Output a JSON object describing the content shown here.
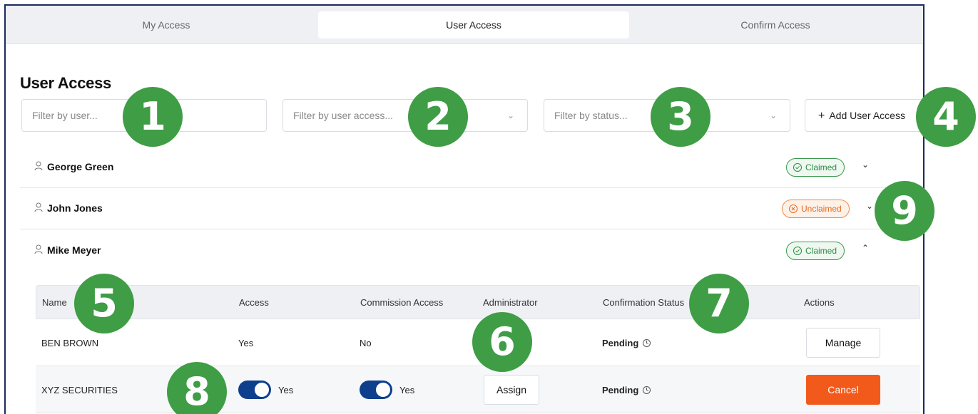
{
  "tabs": [
    {
      "label": "My Access"
    },
    {
      "label": "User Access"
    },
    {
      "label": "Confirm Access"
    }
  ],
  "page_title": "User Access",
  "filters": {
    "user_placeholder": "Filter by user...",
    "access_placeholder": "Filter by user access...",
    "status_placeholder": "Filter by status..."
  },
  "add_button": "Add User Access",
  "users": [
    {
      "name": "George Green",
      "status": "Claimed"
    },
    {
      "name": "John Jones",
      "status": "Unclaimed"
    },
    {
      "name": "Mike Meyer",
      "status": "Claimed"
    }
  ],
  "table": {
    "headers": [
      "Name",
      "Access",
      "Commission Access",
      "Administrator",
      "Confirmation Status",
      "Actions"
    ],
    "rows": [
      {
        "name": "BEN BROWN",
        "access": "Yes",
        "commission": "No",
        "status": "Pending",
        "action": "Manage"
      },
      {
        "name": "XYZ SECURITIES",
        "access": "Yes",
        "commission": "Yes",
        "admin": "Assign",
        "status": "Pending",
        "action": "Cancel"
      }
    ]
  },
  "markers": [
    "1",
    "2",
    "3",
    "4",
    "5",
    "6",
    "7",
    "8",
    "9"
  ],
  "colors": {
    "accent_green": "#3e9d45",
    "claimed": "#2f8a42",
    "unclaimed": "#e56a1f",
    "toggle_on": "#0e3f8c",
    "cancel": "#f15a1b"
  }
}
